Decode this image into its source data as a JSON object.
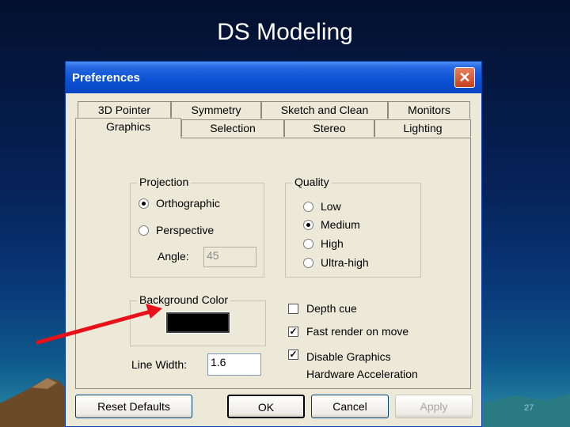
{
  "slide": {
    "title": "DS Modeling",
    "page_number": "27"
  },
  "dialog": {
    "title": "Preferences",
    "close_glyph": "✕",
    "tabs_row_back": [
      "3D Pointer",
      "Symmetry",
      "Sketch and Clean",
      "Monitors"
    ],
    "tabs_row_front": [
      "Graphics",
      "Selection",
      "Stereo",
      "Lighting"
    ],
    "active_tab": "Graphics",
    "projection": {
      "group_label": "Projection",
      "options": [
        "Orthographic",
        "Perspective"
      ],
      "selected": "Orthographic",
      "angle_label": "Angle:",
      "angle_value": "45"
    },
    "quality": {
      "group_label": "Quality",
      "options": [
        "Low",
        "Medium",
        "High",
        "Ultra-high"
      ],
      "selected": "Medium"
    },
    "background": {
      "group_label": "Background Color",
      "color": "#000000"
    },
    "line_width": {
      "label": "Line Width:",
      "value": "1.6"
    },
    "checkboxes": {
      "depth_cue": {
        "label": "Depth cue",
        "checked": false
      },
      "fast_render": {
        "label": "Fast render on move",
        "checked": true
      },
      "disable_accel": {
        "label_line1": "Disable Graphics",
        "label_line2": "Hardware Acceleration",
        "checked": true
      }
    },
    "buttons": {
      "reset": "Reset Defaults",
      "ok": "OK",
      "cancel": "Cancel",
      "apply": "Apply"
    }
  },
  "colors": {
    "titlebar": "#0b52d6",
    "dialog_bg": "#ece9d8",
    "arrow": "#e8111a"
  },
  "icons": {
    "close": "close-icon",
    "check": "checkmark-icon"
  }
}
